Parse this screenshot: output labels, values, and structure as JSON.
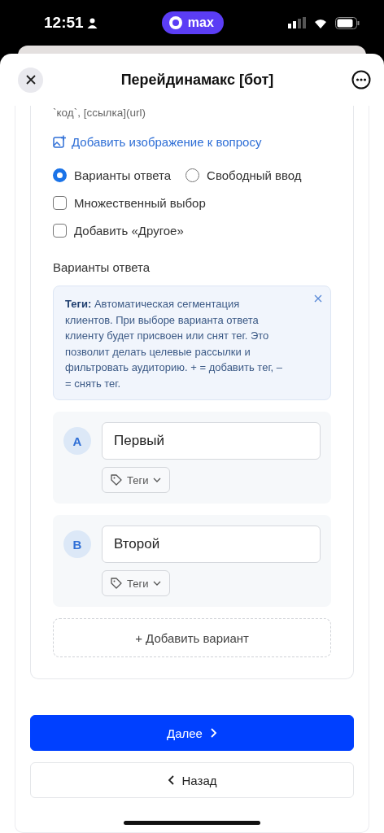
{
  "status_bar": {
    "time": "12:51",
    "app_pill": "max"
  },
  "header": {
    "title": "Перейдинамакс [бот]"
  },
  "editor": {
    "format_hint": "`код`, [ссылка](url)",
    "add_image_link": "Добавить изображение к вопросу",
    "answer_types": [
      {
        "label": "Варианты ответа",
        "selected": true
      },
      {
        "label": "Свободный ввод",
        "selected": false
      }
    ],
    "options": [
      {
        "label": "Множественный выбор",
        "checked": false
      },
      {
        "label": "Добавить «Другое»",
        "checked": false
      }
    ],
    "section_title": "Варианты ответа",
    "info": {
      "text": "**Теги:** Автоматическая сегментация клиентов. При выборе варианта ответа клиенту будет присвоен или снят тег. Это позволит делать целевые рассылки и фильтровать аудиторию. + = добавить тег, – = снять тег."
    },
    "answers": [
      {
        "letter": "A",
        "value": "Первый",
        "tags_label": "Теги"
      },
      {
        "letter": "B",
        "value": "Второй",
        "tags_label": "Теги"
      }
    ],
    "add_button": "+ Добавить вариант"
  },
  "buttons": [
    {
      "label": "Далее",
      "kind": "primary"
    },
    {
      "label": "Назад",
      "kind": "secondary"
    }
  ]
}
